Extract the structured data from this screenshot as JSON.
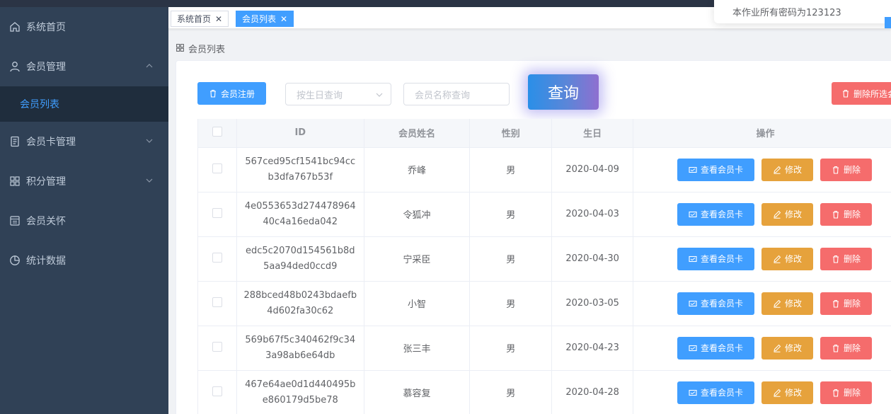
{
  "sidebar": {
    "items": [
      {
        "label": "系统首页",
        "icon": "home-icon"
      },
      {
        "label": "会员管理",
        "icon": "user-icon",
        "expanded": true
      },
      {
        "label": "会员卡管理",
        "icon": "document-icon"
      },
      {
        "label": "积分管理",
        "icon": "grid-icon"
      },
      {
        "label": "会员关怀",
        "icon": "list-icon"
      },
      {
        "label": "统计数据",
        "icon": "pie-chart-icon"
      }
    ],
    "sub_active": "会员列表"
  },
  "tabs": [
    {
      "label": "系统首页",
      "active": false
    },
    {
      "label": "会员列表",
      "active": true
    }
  ],
  "notice": {
    "text": "本作业所有密码为123123"
  },
  "breadcrumb": {
    "label": "会员列表"
  },
  "toolbar": {
    "register_label": "会员注册",
    "birthday_placeholder": "按生日查询",
    "name_placeholder": "会员名称查询",
    "query_label": "查询",
    "delete_selected_label": "删除所选会员"
  },
  "table": {
    "columns": [
      "ID",
      "会员姓名",
      "性别",
      "生日",
      "操作"
    ],
    "actions": {
      "view_card": "查看会员卡",
      "edit": "修改",
      "delete": "删除"
    },
    "rows": [
      {
        "id": "567ced95cf1541bc94ccb3dfa767b53f",
        "name": "乔峰",
        "gender": "男",
        "birthday": "2020-04-09"
      },
      {
        "id": "4e0553653d27447896440c4a16eda042",
        "name": "令狐冲",
        "gender": "男",
        "birthday": "2020-04-03"
      },
      {
        "id": "edc5c2070d154561b8d5aa94ded0ccd9",
        "name": "宁采臣",
        "gender": "男",
        "birthday": "2020-04-30"
      },
      {
        "id": "288bced48b0243bdaefb4d602fa30c62",
        "name": "小智",
        "gender": "男",
        "birthday": "2020-03-05"
      },
      {
        "id": "569b67f5c340462f9c343a98ab6e64db",
        "name": "张三丰",
        "gender": "男",
        "birthday": "2020-04-23"
      },
      {
        "id": "467e64ae0d1d440495be860179d5be78",
        "name": "慕容复",
        "gender": "男",
        "birthday": "2020-04-28"
      }
    ]
  },
  "colors": {
    "primary": "#409eff",
    "warning": "#e6a23c",
    "danger": "#f56c6c",
    "sidebar": "#304156"
  }
}
